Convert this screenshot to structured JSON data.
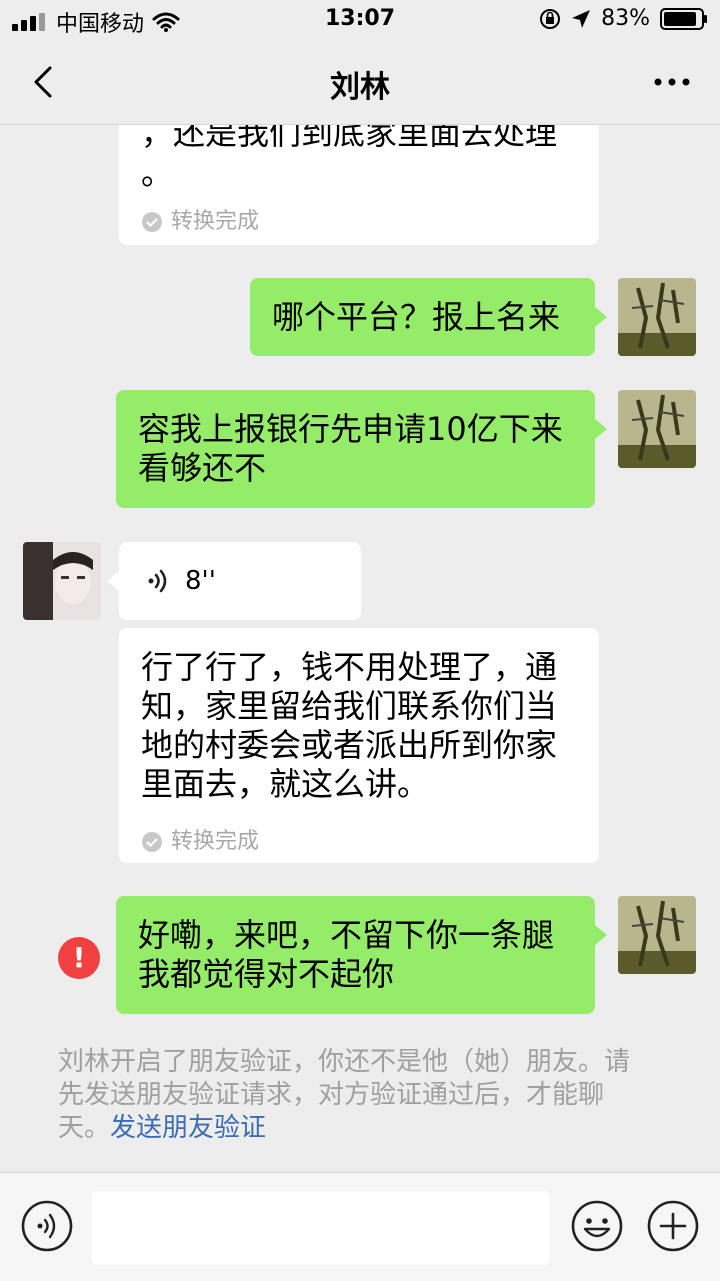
{
  "status": {
    "carrier": "中国移动",
    "time": "13:07",
    "battery": "83%"
  },
  "nav": {
    "title": "刘林"
  },
  "messages": {
    "m0_text_line1": "，还是我们到底家里面去处理",
    "m0_text_line2": "。",
    "m0_status": "转换完成",
    "m1_text": "哪个平台？报上名来",
    "m2_text_line1": "容我上报银行先申请10亿下来",
    "m2_text_line2": "看够还不",
    "m3_voice_duration": "8''",
    "m4_text_line1": "行了行了，钱不用处理了，通",
    "m4_text_line2": "知，家里留给我们联系你们当",
    "m4_text_line3": "地的村委会或者派出所到你家",
    "m4_text_line4": "里面去，就这么讲。",
    "m4_status": "转换完成",
    "m5_text_line1": "好嘞，来吧，不留下你一条腿",
    "m5_text_line2": "我都觉得对不起你",
    "m5_error_mark": "!"
  },
  "system_notice": {
    "text_line1": "刘林开启了朋友验证，你还不是他（她）朋友。请",
    "text_line2": "先发送朋友验证请求，对方验证通过后，才能聊",
    "text_line3_prefix": "天。",
    "link": "发送朋友验证"
  },
  "colors": {
    "bubble_self": "#95ec69",
    "bubble_other": "#ffffff",
    "background": "#ededed",
    "link": "#3b6cb5",
    "error": "#f04040"
  }
}
